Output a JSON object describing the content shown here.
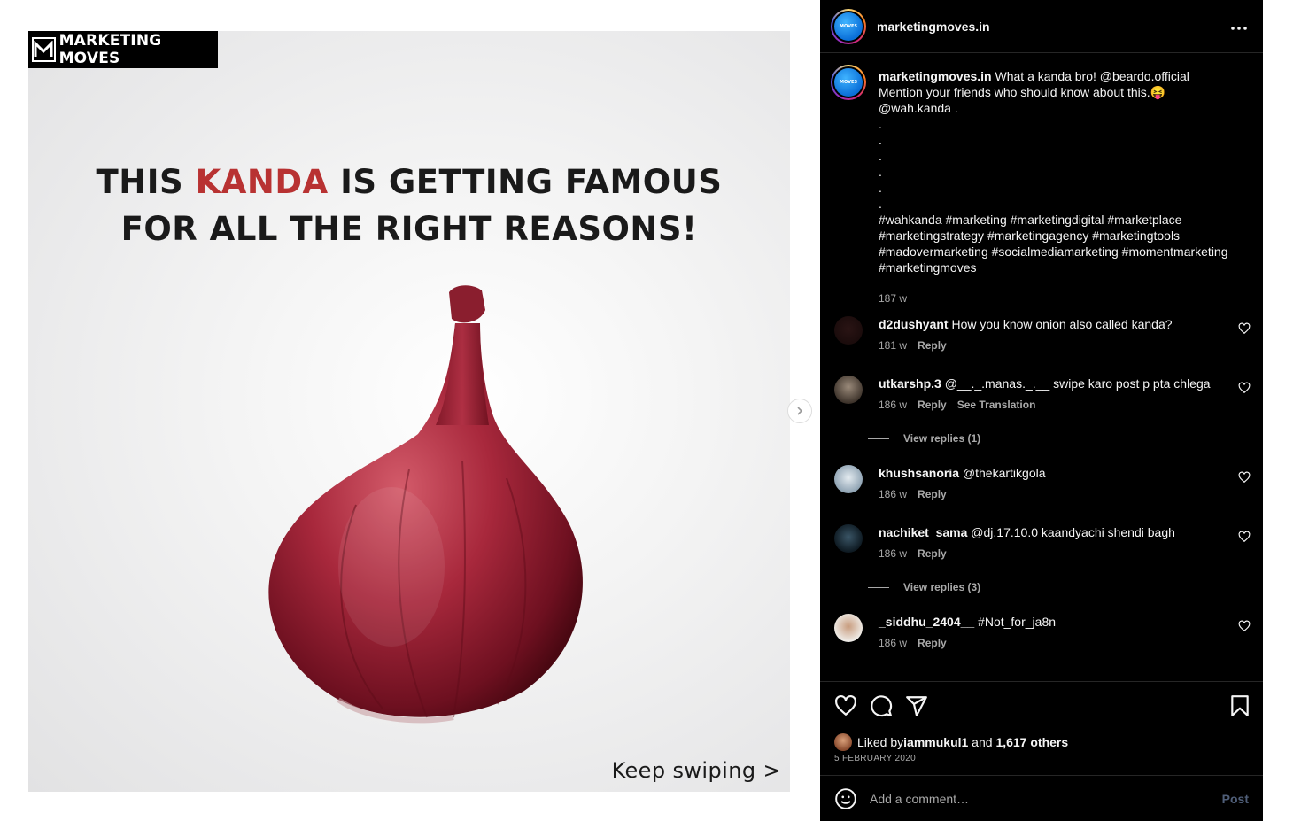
{
  "post_image": {
    "brand": "MARKETING MOVES",
    "headline_line1_pre": "THIS ",
    "headline_line1_accent": "KANDA",
    "headline_line1_post": " IS GETTING FAMOUS",
    "headline_line2": "FOR ALL THE RIGHT REASONS!",
    "footer": "Keep swiping >"
  },
  "header": {
    "username": "marketingmoves.in",
    "avatar_text": "MOVES",
    "more_icon": "more-horizontal-icon"
  },
  "caption": {
    "username": "marketingmoves.in",
    "text": " What a kanda bro! @beardo.official\nMention your friends who should know about this.😝\n@wah.kanda .\n.\n.\n.\n.\n.\n.\n#wahkanda #marketing #marketingdigital #marketplace\n#marketingstrategy #marketingagency #marketingtools\n#madovermarketing #socialmediamarketing #momentmarketing\n#marketingmoves",
    "time": "187 w"
  },
  "comments": [
    {
      "username": "d2dushyant",
      "text": " How you know onion also called kanda?",
      "time": "181 w",
      "reply": "Reply"
    },
    {
      "username": "utkarshp.3",
      "text": " @__._.manas._.__ swipe karo post p pta chlega",
      "time": "186 w",
      "reply": "Reply",
      "translate": "See Translation",
      "view_replies": "View replies (1)"
    },
    {
      "username": "khushsanoria",
      "text": " @thekartikgola",
      "time": "186 w",
      "reply": "Reply"
    },
    {
      "username": "nachiket_sama",
      "text": " @dj.17.10.0 kaandyachi shendi bagh",
      "time": "186 w",
      "reply": "Reply",
      "view_replies": "View replies (3)"
    },
    {
      "username": "_siddhu_2404__",
      "text": " #Not_for_ja8n",
      "time": "186 w",
      "reply": "Reply"
    }
  ],
  "likes": {
    "prefix": "Liked by ",
    "user": "iammukul1",
    "middle": " and ",
    "others": "1,617 others",
    "date": "5 FEBRUARY 2020"
  },
  "composer": {
    "placeholder": "Add a comment…",
    "post_label": "Post"
  },
  "colors": {
    "accent_red": "#b83232",
    "sidebar_bg": "#000000",
    "muted": "#a8a8a8"
  }
}
